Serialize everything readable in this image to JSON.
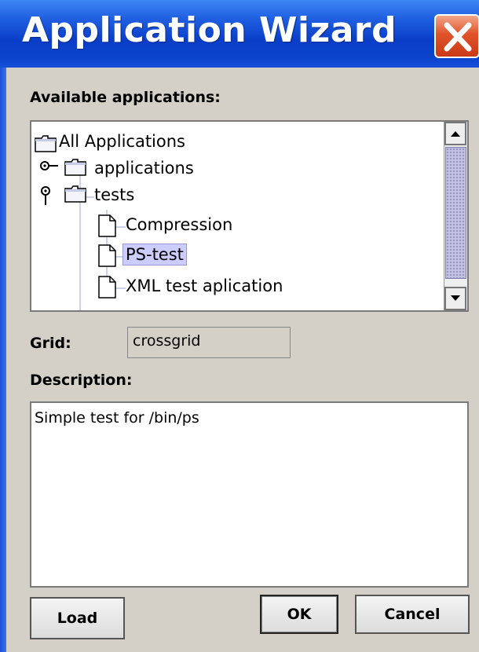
{
  "window": {
    "title": "Application Wizard",
    "close_icon": "close-x-icon",
    "title_color": "#0a3ec8",
    "close_color": "#e0532a"
  },
  "available": {
    "label": "Available applications:",
    "tree": {
      "root": {
        "label": "All Applications",
        "icon": "folder-icon"
      },
      "nodes": [
        {
          "label": "applications",
          "icon": "folder-icon",
          "expander": "collapsed"
        },
        {
          "label": "tests",
          "icon": "folder-icon",
          "expander": "expanded"
        }
      ],
      "leaves": [
        {
          "label": "Compression",
          "icon": "document-icon",
          "selected": false
        },
        {
          "label": "PS-test",
          "icon": "document-icon",
          "selected": true
        },
        {
          "label": "XML test aplication",
          "icon": "document-icon",
          "selected": false
        }
      ],
      "selection_color": "#ccccff"
    }
  },
  "grid": {
    "label": "Grid:",
    "value": "crossgrid"
  },
  "description": {
    "label": "Description:",
    "text": "Simple test for /bin/ps"
  },
  "buttons": {
    "load": "Load",
    "ok": "OK",
    "cancel": "Cancel"
  }
}
